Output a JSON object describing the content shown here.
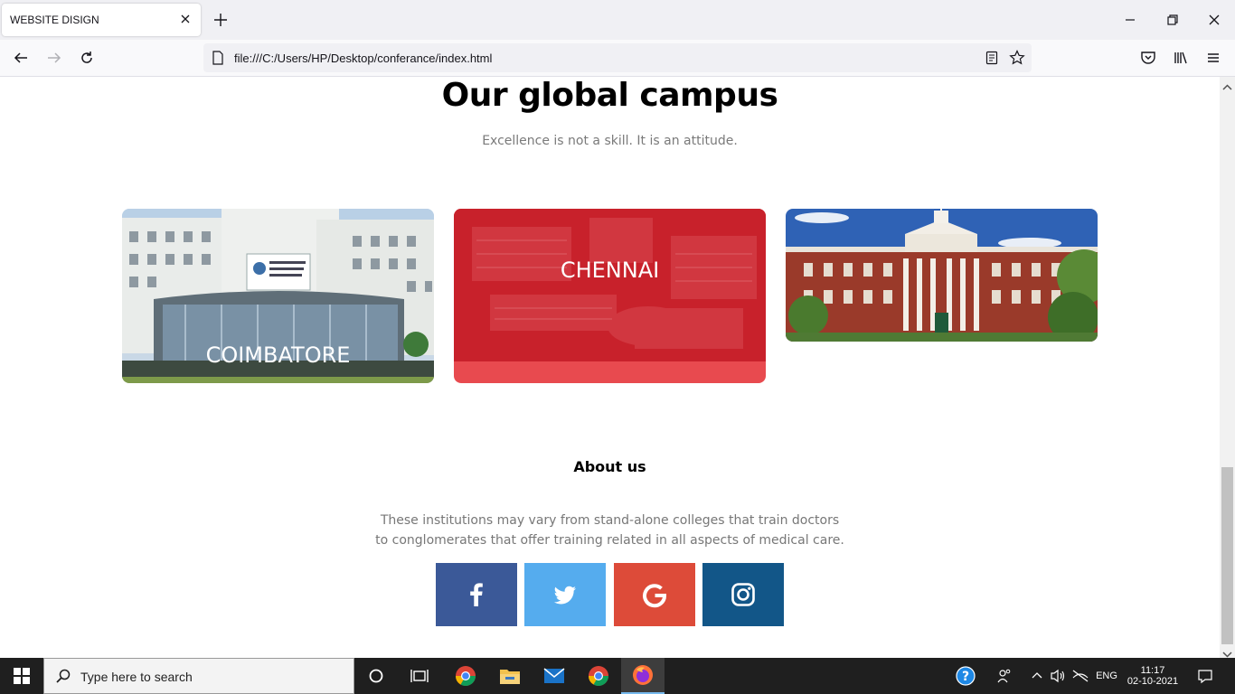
{
  "browser": {
    "tab_title": "WEBSITE DISIGN",
    "url": "file:///C:/Users/HP/Desktop/conferance/index.html"
  },
  "campus": {
    "title": "Our global campus",
    "subtitle": "Excellence is not a skill. It is an attitude.",
    "cards": [
      {
        "label": "COIMBATORE"
      },
      {
        "label": "CHENNAI"
      },
      {
        "label": ""
      }
    ]
  },
  "about": {
    "title": "About us",
    "text_line1": "These institutions may vary from stand-alone colleges that train doctors",
    "text_line2": "to conglomerates that offer training related in all aspects of medical care."
  },
  "social": [
    {
      "name": "facebook",
      "color": "#3b5998"
    },
    {
      "name": "twitter",
      "color": "#55acee"
    },
    {
      "name": "google",
      "color": "#dd4b39"
    },
    {
      "name": "instagram",
      "color": "#125688"
    }
  ],
  "taskbar": {
    "search_placeholder": "Type here to search",
    "language": "ENG",
    "time": "11:17",
    "date": "02-10-2021"
  },
  "colors": {
    "accent_red": "#e84a4f",
    "chennai_overlay": "#d6252f"
  }
}
